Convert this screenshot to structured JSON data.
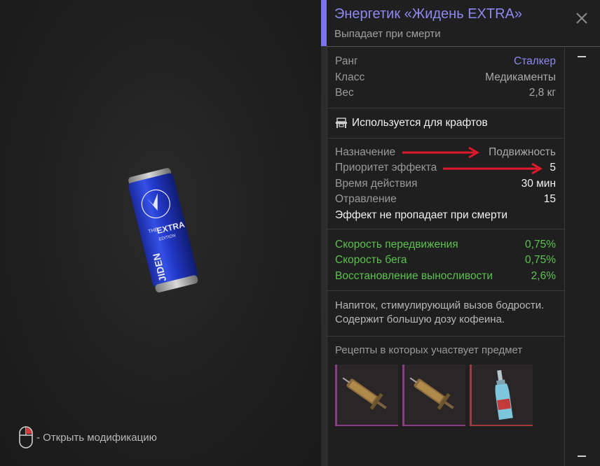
{
  "header": {
    "title": "Энергетик «Жидень EXTRA»",
    "subtitle": "Выпадает при смерти"
  },
  "stats": [
    {
      "label": "Ранг",
      "value": "Сталкер"
    },
    {
      "label": "Класс",
      "value": "Медикаменты"
    },
    {
      "label": "Вес",
      "value": "2,8 кг"
    }
  ],
  "craft": {
    "label": "Используется для крафтов",
    "icon": "workbench-icon"
  },
  "effects": [
    {
      "label": "Назначение",
      "value": "Подвижность"
    },
    {
      "label": "Приоритет эффекта",
      "value": "5"
    },
    {
      "label": "Время действия",
      "value": "30 мин"
    },
    {
      "label": "Отравление",
      "value": "15"
    }
  ],
  "effect_note": "Эффект не пропадает при смерти",
  "bonuses": [
    {
      "label": "Скорость передвижения",
      "value": "0,75%"
    },
    {
      "label": "Скорость бега",
      "value": "0,75%"
    },
    {
      "label": "Восстановление выносливости",
      "value": "2,6%"
    }
  ],
  "description": "Напиток, стимулирующий вызов бодрости. Содержит большую дозу кофеина.",
  "recipes": {
    "title": "Рецепты в которых участвует предмет",
    "items": [
      {
        "icon": "syringe-icon",
        "rarity_color": "#8b3d83"
      },
      {
        "icon": "syringe-icon",
        "rarity_color": "#8b3d83"
      },
      {
        "icon": "bottle-icon",
        "rarity_color": "#a03a3c"
      }
    ]
  },
  "preview": {
    "hint": "- Открыть модификацию",
    "can_text": [
      "THE",
      "EXTRA",
      "EDITION",
      "JIDEN"
    ]
  },
  "colors": {
    "accent": "#8f88f2",
    "positive": "#5cc24e",
    "annotation_arrow": "#e0192b"
  }
}
